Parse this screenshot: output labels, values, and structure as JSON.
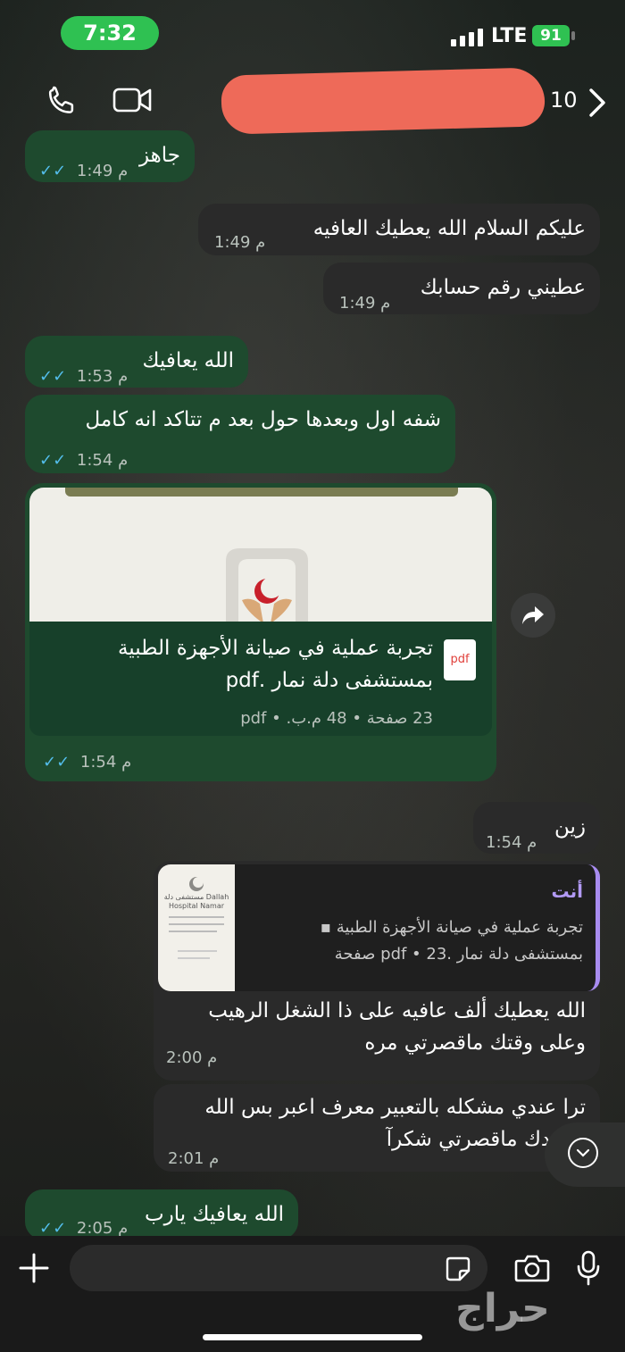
{
  "status_bar": {
    "time": "7:32",
    "network": "LTE",
    "battery": "91"
  },
  "header": {
    "contact_suffix": "10"
  },
  "messages": [
    {
      "text": "جاهز",
      "time": "1:49 م"
    },
    {
      "text": "عليكم السلام الله يعطيك العافيه",
      "time": "1:49 م"
    },
    {
      "text": "عطيني رقم حسابك",
      "time": "1:49 م"
    },
    {
      "text": "الله يعافيك",
      "time": "1:53 م"
    },
    {
      "text": "شفه اول وبعدها حول بعد م تتاكد انه كامل",
      "time": "1:54 م"
    }
  ],
  "document": {
    "icon_label": "pdf",
    "title_line1": "تجربة عملية في صيانة الأجهزة الطبية",
    "title_line2": "بمستشفى دلة نمار .pdf",
    "meta": "23 صفحة • 48 م.ب. • pdf",
    "time": "1:54 م"
  },
  "msg_zain": {
    "text": "زين",
    "time": "1:54 م"
  },
  "reply": {
    "author": "أنت",
    "quoted_line1": "تجربة عملية في صيانة الأجهزة الطبية",
    "quoted_line2": "بمستشفى دلة نمار .pdf • 23 صفحة",
    "thumb_text": "مستشفى دلة Dallah Hospital Namar",
    "line1": "الله يعطيك ألف عافيه على ذا الشغل الرهيب",
    "line2": "وعلى وقتك ماقصرتي مره",
    "time": "2:00 م"
  },
  "msg_trouble": {
    "line1": "ترا عندي مشكله بالتعبير معرف اعبر بس الله",
    "line2": "يسعدك ماقصرتي شكرآ",
    "time": "2:01 م"
  },
  "msg_last": {
    "text": "الله يعافيك يارب",
    "time": "2:05 م"
  },
  "watermark": "حراج"
}
